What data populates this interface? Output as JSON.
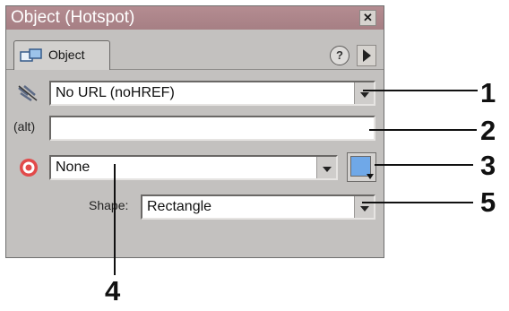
{
  "window": {
    "title": "Object (Hotspot)",
    "close_glyph": "✕"
  },
  "tab": {
    "label": "Object",
    "icon": "object-icon"
  },
  "help_glyph": "?",
  "url": {
    "icon": "link-icon",
    "value": "No URL (noHREF)"
  },
  "alt": {
    "label": "(alt)",
    "value": ""
  },
  "target": {
    "icon": "target-icon",
    "value": "None"
  },
  "shape": {
    "label": "Shape:",
    "value": "Rectangle"
  },
  "swatch_color": "#6fa8e8",
  "callouts": [
    "1",
    "2",
    "3",
    "4",
    "5"
  ]
}
